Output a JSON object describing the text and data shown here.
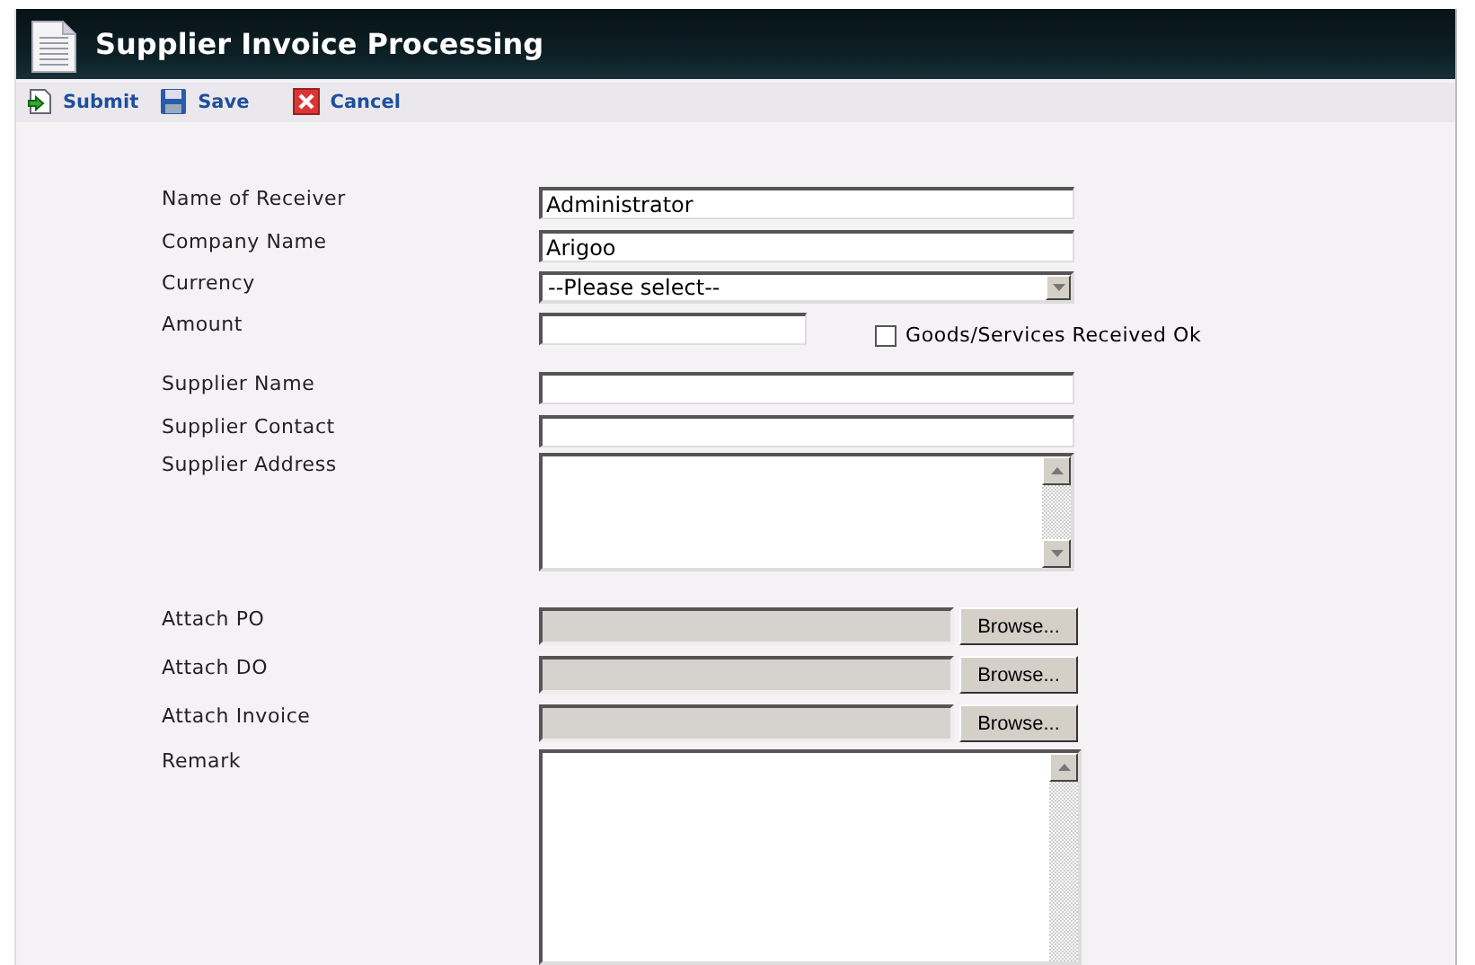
{
  "window": {
    "title": "Supplier Invoice Processing"
  },
  "toolbar": [
    {
      "kind": "submit",
      "label": "Submit"
    },
    {
      "kind": "save",
      "label": "Save"
    },
    {
      "kind": "cancel",
      "label": "Cancel"
    }
  ],
  "fields": [
    {
      "kind": "text",
      "label": "Name of Receiver",
      "value": "Administrator"
    },
    {
      "kind": "text",
      "label": "Company Name",
      "value": "Arigoo"
    },
    {
      "kind": "select",
      "label": "Currency",
      "value": "--Please select--"
    },
    {
      "kind": "short",
      "label": "Amount",
      "checkbox": {
        "label": "Goods/Services Received Ok",
        "checked": false
      }
    },
    {
      "kind": "text",
      "label": "Supplier Name"
    },
    {
      "kind": "text",
      "label": "Supplier Contact"
    },
    {
      "kind": "textarea",
      "label": "Supplier Address"
    },
    {
      "kind": "file",
      "label": "Attach PO",
      "button": "Browse..."
    },
    {
      "kind": "file",
      "label": "Attach DO",
      "button": "Browse..."
    },
    {
      "kind": "file",
      "label": "Attach Invoice",
      "button": "Browse..."
    },
    {
      "kind": "bigtextarea",
      "label": "Remark"
    }
  ]
}
